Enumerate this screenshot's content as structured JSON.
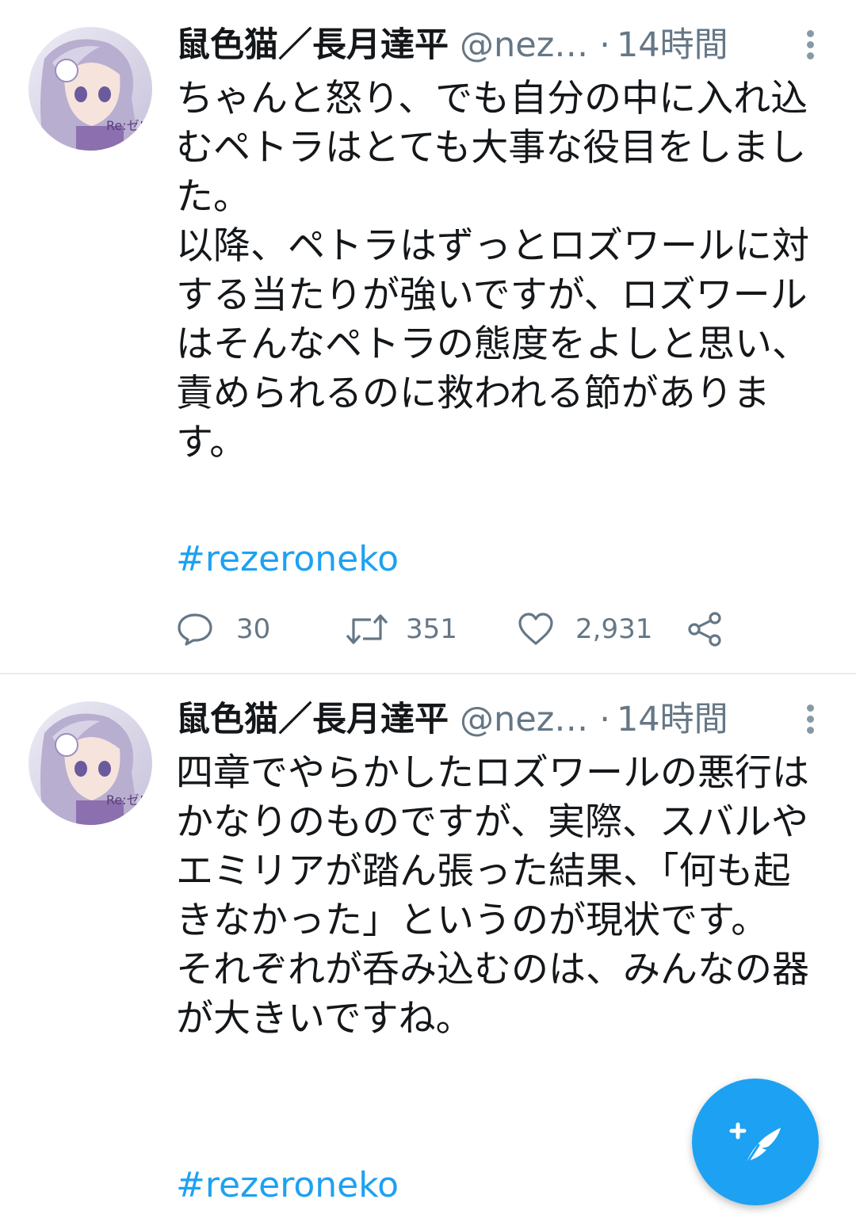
{
  "colors": {
    "accent": "#1da1f2",
    "secondary_text": "#657786",
    "primary_text": "#14171a",
    "divider": "#e6ecf0"
  },
  "tweets": [
    {
      "display_name": "鼠色猫／長月達平",
      "handle": "@nez…",
      "separator": "·",
      "time": "14時間",
      "body": [
        "ちゃんと怒り、でも自分の中に入れ込むペトラはとても大事な役目をしました。",
        "以降、ペトラはずっとロズワールに対する当たりが強いですが、ロズワールはそんなペトラの態度をよしと思い、責められるのに救われる節があります。"
      ],
      "hashtag": "#rezeroneko",
      "replies": "30",
      "retweets": "351",
      "likes": "2,931"
    },
    {
      "display_name": "鼠色猫／長月達平",
      "handle": "@nez…",
      "separator": "·",
      "time": "14時間",
      "body": [
        "四章でやらかしたロズワールの悪行はかなりのものですが、実際、スバルやエミリアが踏ん張った結果、「何も起きなかった」というのが現状です。",
        "それぞれが呑み込むのは、みんなの器が大きいですね。"
      ],
      "hashtag": "#rezeroneko"
    }
  ],
  "avatar_text": "Re:ゼロ",
  "icons": {
    "reply": "reply-icon",
    "retweet": "retweet-icon",
    "like": "heart-icon",
    "share": "share-icon",
    "more": "more-vertical-icon",
    "compose": "compose-tweet-icon"
  }
}
